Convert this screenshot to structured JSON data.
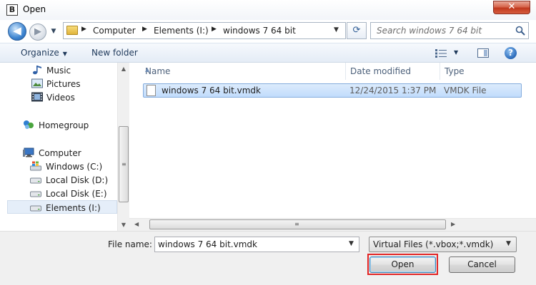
{
  "window": {
    "title": "Open",
    "app_icon_letter": "B",
    "close_glyph": "✕"
  },
  "nav": {
    "back_glyph": "◀",
    "forward_glyph": "▶",
    "history_glyph": "▼"
  },
  "address": {
    "breadcrumbs": [
      "Computer",
      "Elements (I:)",
      "windows 7 64 bit"
    ],
    "separator": "▶",
    "dropdown_glyph": "▼"
  },
  "refresh": {
    "glyph": "⟳"
  },
  "search": {
    "placeholder": "Search windows 7 64 bit"
  },
  "toolbar": {
    "organize": "Organize",
    "new_folder": "New folder",
    "caret": "▼",
    "help": "?"
  },
  "sidebar": {
    "items": [
      {
        "label": "Music",
        "icon": "music-icon"
      },
      {
        "label": "Pictures",
        "icon": "pictures-icon"
      },
      {
        "label": "Videos",
        "icon": "videos-icon"
      },
      {
        "label": "Homegroup",
        "icon": "homegroup-icon"
      },
      {
        "label": "Computer",
        "icon": "computer-icon"
      },
      {
        "label": "Windows (C:)",
        "icon": "windows-drive-icon"
      },
      {
        "label": "Local Disk (D:)",
        "icon": "drive-icon"
      },
      {
        "label": "Local Disk (E:)",
        "icon": "drive-icon"
      },
      {
        "label": "Elements (I:)",
        "icon": "drive-icon",
        "selected": true
      }
    ]
  },
  "scroll": {
    "up": "▲",
    "down": "▼",
    "left": "◀",
    "right": "▶",
    "grip": "≡"
  },
  "file_list": {
    "columns": [
      "Name",
      "Date modified",
      "Type"
    ],
    "sort_glyph": "▲",
    "rows": [
      {
        "name": "windows 7 64 bit.vmdk",
        "date": "12/24/2015 1:37 PM",
        "type": "VMDK File"
      }
    ]
  },
  "bottom": {
    "file_name_label": "File name:",
    "file_name_value": "windows 7 64 bit.vmdk",
    "file_name_drop": "▼",
    "filter": "Virtual Files (*.vbox;*.vmdk)",
    "filter_drop": "▼",
    "open_button": "Open",
    "cancel_button": "Cancel"
  },
  "colors": {
    "highlight": "#e22424",
    "selection": "#c1dcfc",
    "toolbar_text": "#1e395b"
  }
}
